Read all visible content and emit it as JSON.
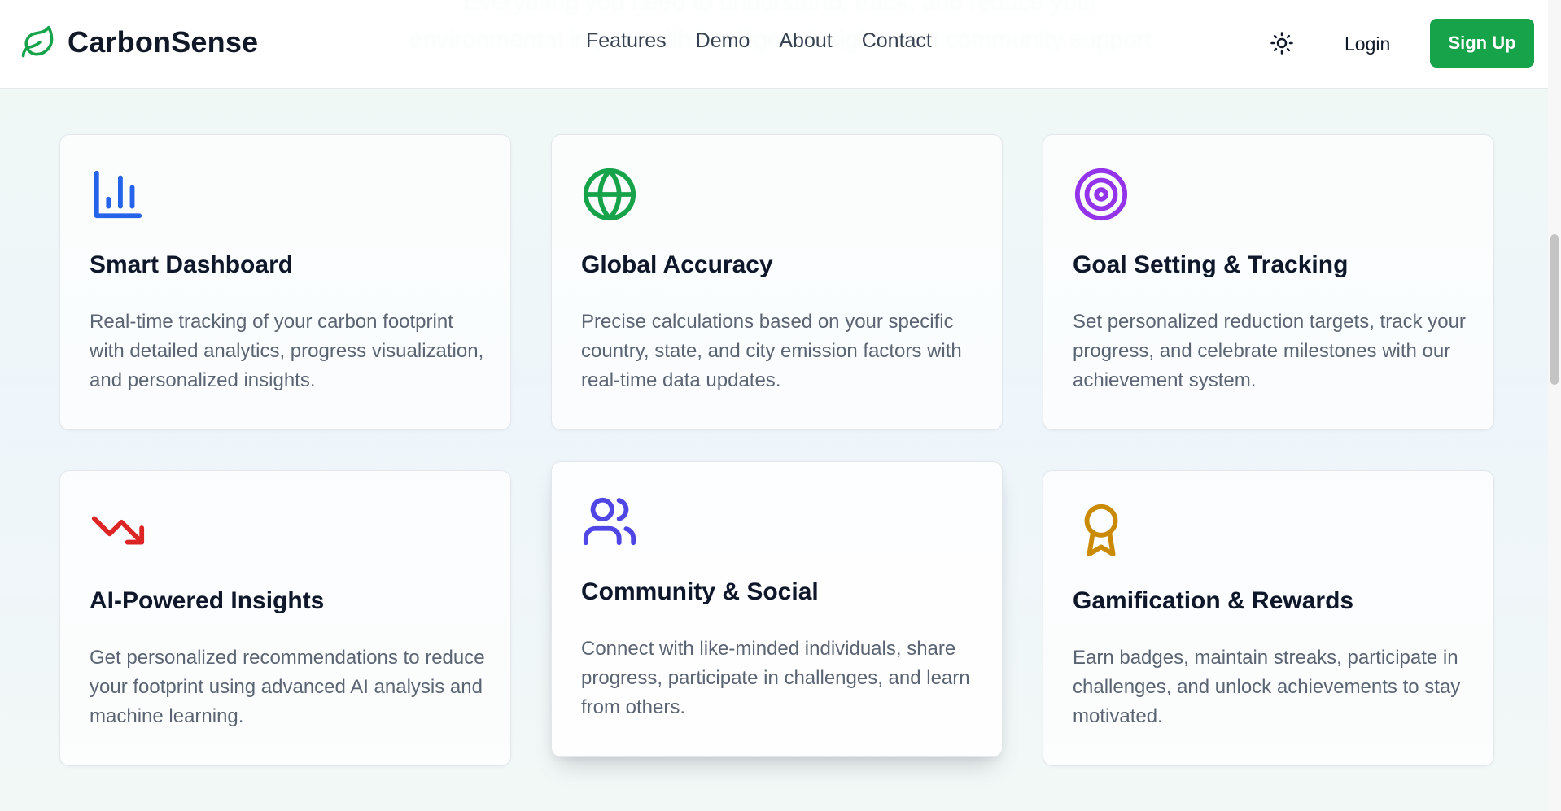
{
  "hero": {
    "ghost_line1": "Everything you need to understand, track, and reduce your",
    "ghost_line2": "environmental impact with intelligent insights and community support"
  },
  "navbar": {
    "brand": "CarbonSense",
    "links": [
      "Features",
      "Demo",
      "About",
      "Contact"
    ],
    "login_label": "Login",
    "signup_label": "Sign Up",
    "theme_icon": "sun-icon",
    "accent_color": "#16a34a"
  },
  "features": [
    {
      "icon": "bar-chart-icon",
      "color": "#2563eb",
      "title": "Smart Dashboard",
      "description": "Real-time tracking of your carbon footprint with detailed analytics, progress visualization, and personalized insights."
    },
    {
      "icon": "globe-icon",
      "color": "#16a34a",
      "title": "Global Accuracy",
      "description": "Precise calculations based on your specific country, state, and city emission factors with real-time data updates."
    },
    {
      "icon": "target-icon",
      "color": "#9333ea",
      "title": "Goal Setting & Tracking",
      "description": "Set personalized reduction targets, track your progress, and celebrate milestones with our achievement system."
    },
    {
      "icon": "trending-down-icon",
      "color": "#dc2626",
      "title": "AI-Powered Insights",
      "description": "Get personalized recommendations to reduce your footprint using advanced AI analysis and machine learning."
    },
    {
      "icon": "users-icon",
      "color": "#4f46e5",
      "title": "Community & Social",
      "description": "Connect with like-minded individuals, share progress, participate in challenges, and learn from others."
    },
    {
      "icon": "award-icon",
      "color": "#ca8a04",
      "title": "Gamification & Rewards",
      "description": "Earn badges, maintain streaks, participate in challenges, and unlock achievements to stay motivated."
    }
  ]
}
